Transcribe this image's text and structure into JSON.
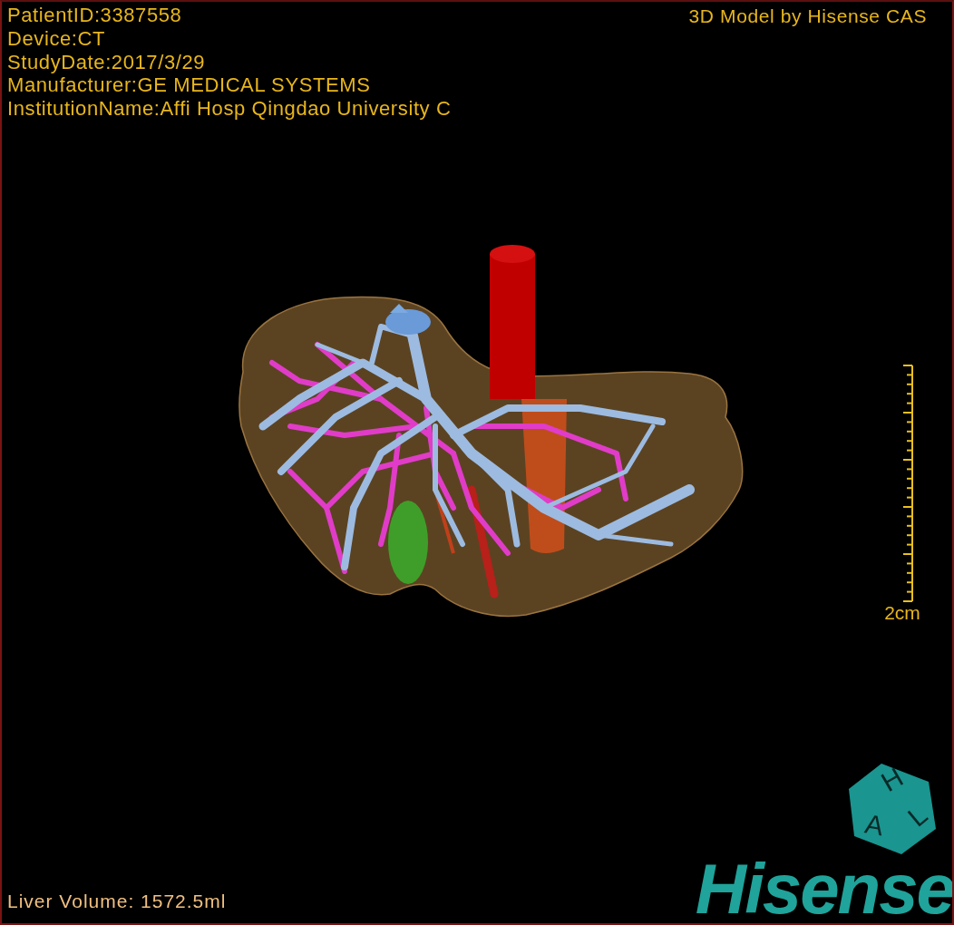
{
  "info_lines": [
    "PatientID:3387558",
    "Device:CT",
    "StudyDate:2017/3/29",
    "Manufacturer:GE MEDICAL SYSTEMS",
    "InstitutionName:Affi Hosp Qingdao University C"
  ],
  "title": "3D Model by Hisense CAS",
  "scale": {
    "label": "2cm"
  },
  "volume": "Liver Volume: 1572.5ml",
  "cube": {
    "letters": [
      "H",
      "A",
      "L"
    ]
  },
  "logo": "Hisense"
}
